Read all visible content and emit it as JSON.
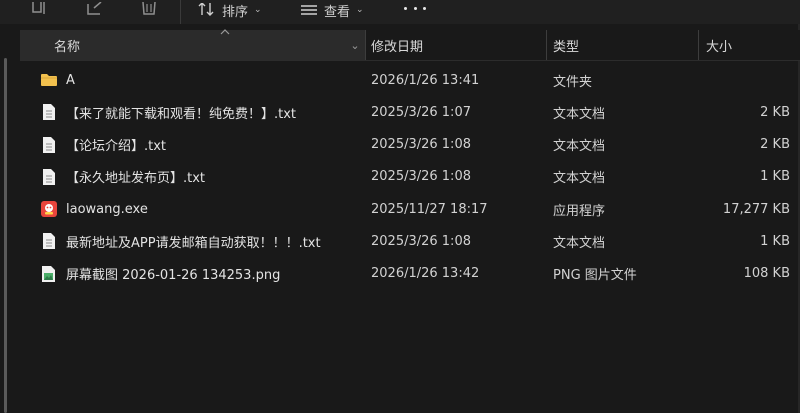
{
  "toolbar": {
    "sort_label": "排序",
    "view_label": "查看"
  },
  "header": {
    "columns": {
      "name": "名称",
      "date": "修改日期",
      "type": "类型",
      "size": "大小"
    }
  },
  "files": [
    {
      "name": "A",
      "date": "2026/1/26 13:41",
      "type": "文件夹",
      "size": "",
      "icon": "folder-icon"
    },
    {
      "name": "【来了就能下载和观看！纯免费！】.txt",
      "date": "2025/3/26 1:07",
      "type": "文本文档",
      "size": "2 KB",
      "icon": "text-file-icon"
    },
    {
      "name": "【论坛介绍】.txt",
      "date": "2025/3/26 1:08",
      "type": "文本文档",
      "size": "2 KB",
      "icon": "text-file-icon"
    },
    {
      "name": "【永久地址发布页】.txt",
      "date": "2025/3/26 1:08",
      "type": "文本文档",
      "size": "1 KB",
      "icon": "text-file-icon"
    },
    {
      "name": "laowang.exe",
      "date": "2025/11/27 18:17",
      "type": "应用程序",
      "size": "17,277 KB",
      "icon": "app-icon"
    },
    {
      "name": "最新地址及APP请发邮箱自动获取！！！.txt",
      "date": "2025/3/26 1:08",
      "type": "文本文档",
      "size": "1 KB",
      "icon": "text-file-icon"
    },
    {
      "name": "屏幕截图 2026-01-26 134253.png",
      "date": "2026/1/26 13:42",
      "type": "PNG 图片文件",
      "size": "108 KB",
      "icon": "image-file-icon"
    }
  ],
  "colors": {
    "background": "#191919",
    "folder": "#f2c14e",
    "app": "#e8453c"
  }
}
